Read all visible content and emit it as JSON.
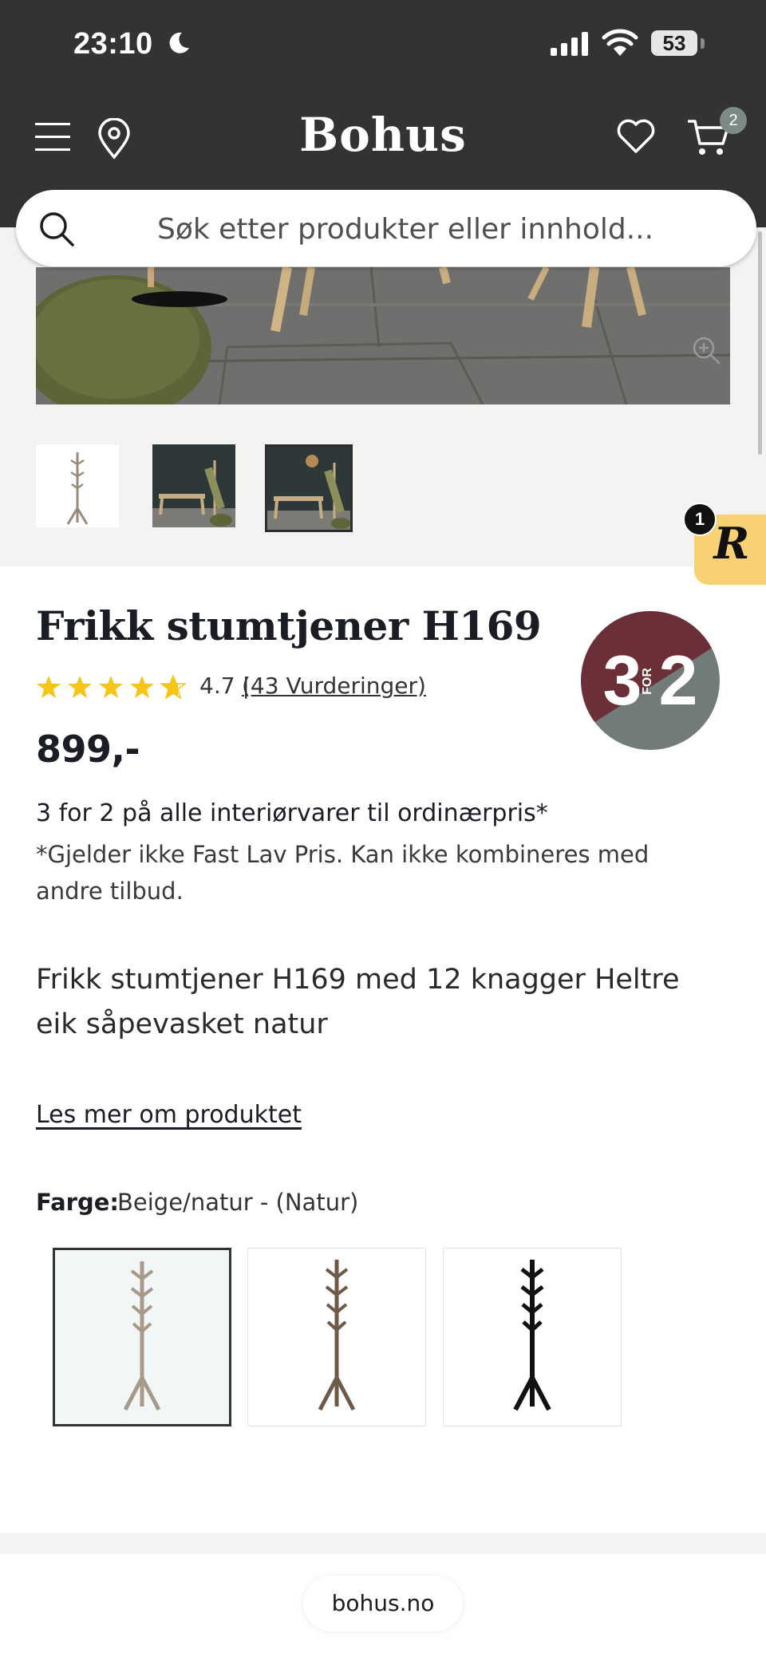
{
  "status_bar": {
    "time": "23:10",
    "battery": "53"
  },
  "header": {
    "logo": "Bohus",
    "cart_count": "2"
  },
  "search": {
    "placeholder": "Søk etter produkter eller innhold..."
  },
  "gallery": {
    "thumbnails": [
      "Produktbilde 1",
      "Produktbilde 2",
      "Produktbilde 3"
    ],
    "selected_index": 2
  },
  "reviews_widget": {
    "letter": "R",
    "count": "1"
  },
  "product": {
    "title": "Frikk stumtjener H169",
    "rating_value": "4.7",
    "rating_separator": "|",
    "rating_link": "(43 Vurderinger)",
    "stars": 4.7,
    "price": "899,-",
    "promo_badge": {
      "left": "3",
      "middle": "FOR",
      "right": "2"
    },
    "offer_title": "3 for 2 på alle interiørvarer til ordinærpris*",
    "offer_note": "*Gjelder ikke Fast Lav Pris. Kan ikke kombineres med andre tilbud.",
    "description": "Frikk stumtjener H169 med 12 knagger Heltre eik såpevasket natur",
    "read_more": "Les mer om produktet",
    "color_label": "Farge:",
    "color_value": "Beige/natur - (Natur)",
    "color_options": [
      "#a89a88",
      "#6e5a48",
      "#111111"
    ]
  },
  "footer": {
    "url": "bohus.no"
  },
  "colors": {
    "header_bg": "#333335",
    "badge_dark": "#6a2f37",
    "badge_grey": "#717b7a",
    "star": "#f5c518"
  }
}
